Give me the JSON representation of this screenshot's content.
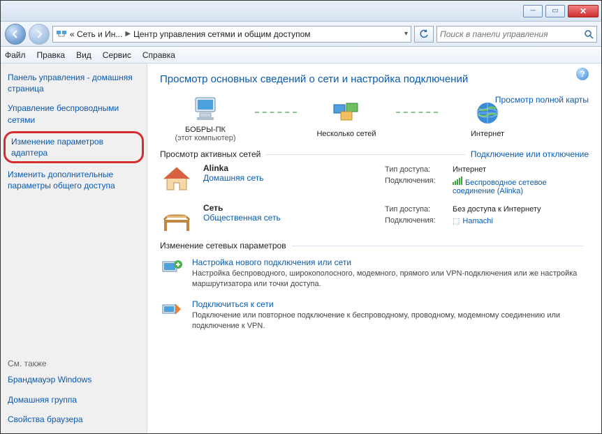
{
  "breadcrumb": {
    "part1": "« Сеть и Ин...",
    "part2": "Центр управления сетями и общим доступом"
  },
  "search": {
    "placeholder": "Поиск в панели управления"
  },
  "menu": {
    "file": "Файл",
    "edit": "Правка",
    "view": "Вид",
    "tools": "Сервис",
    "help": "Справка"
  },
  "sidebar": {
    "home": "Панель управления - домашняя страница",
    "wireless": "Управление беспроводными сетями",
    "adapter": "Изменение параметров адаптера",
    "sharing": "Изменить дополнительные параметры общего доступа",
    "also_hdr": "См. также",
    "firewall": "Брандмауэр Windows",
    "homegroup": "Домашняя группа",
    "browser": "Свойства браузера"
  },
  "heading": "Просмотр основных сведений о сети и настройка подключений",
  "fullmap": "Просмотр полной карты",
  "map": {
    "node1": "БОБРЫ-ПК",
    "node1_sub": "(этот компьютер)",
    "node2": "Несколько сетей",
    "node3": "Интернет"
  },
  "sect_active": "Просмотр активных сетей",
  "conn_toggle": "Подключение или отключение",
  "labels": {
    "access": "Тип доступа:",
    "conn": "Подключения:"
  },
  "net1": {
    "name": "Alinka",
    "type": "Домашняя сеть",
    "access": "Интернет",
    "conn": "Беспроводное сетевое соединение (Alinka)"
  },
  "net2": {
    "name": "Сеть",
    "type": "Общественная сеть",
    "access": "Без доступа к Интернету",
    "conn": "Hamachi"
  },
  "sect_change": "Изменение сетевых параметров",
  "task1": {
    "title": "Настройка нового подключения или сети",
    "desc": "Настройка беспроводного, широкополосного, модемного, прямого или VPN-подключения или же настройка маршрутизатора или точки доступа."
  },
  "task2": {
    "title": "Подключиться к сети",
    "desc": "Подключение или повторное подключение к беспроводному, проводному, модемному соединению или подключение к VPN."
  }
}
